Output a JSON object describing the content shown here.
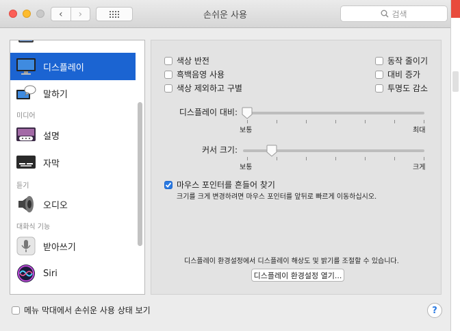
{
  "window": {
    "title": "손쉬운 사용"
  },
  "toolbar": {
    "back": "‹",
    "forward": "›"
  },
  "search": {
    "placeholder": "검색"
  },
  "sidebar": {
    "items": [
      {
        "label": "디스플레이",
        "selected": true
      },
      {
        "label": "말하기"
      },
      {
        "label": "설명"
      },
      {
        "label": "자막"
      },
      {
        "label": "오디오"
      },
      {
        "label": "받아쓰기"
      },
      {
        "label": "Siri"
      }
    ],
    "headers": [
      "미디어",
      "듣기",
      "대화식 기능"
    ]
  },
  "display": {
    "options": {
      "invert_colors": "색상 반전",
      "grayscale": "흑백음영 사용",
      "differentiate": "색상 제외하고 구별",
      "reduce_motion": "동작 줄이기",
      "increase_contrast": "대비 증가",
      "reduce_transparency": "투명도 감소"
    },
    "contrast": {
      "label": "디스플레이 대비:",
      "min": "보통",
      "max": "최대",
      "value": 0
    },
    "cursor": {
      "label": "커서 크기:",
      "min": "보통",
      "max": "크게",
      "value": 0.15
    },
    "shake": {
      "label": "마우스 포인터를 흔들어 찾기",
      "checked": true,
      "hint": "크기를 크게 변경하려면 마우스 포인터를 앞뒤로 빠르게 이동하십시오."
    },
    "footer_text": "디스플레이 환경설정에서 디스플레이 해상도 및 밝기를 조절할 수 있습니다.",
    "open_button": "디스플레이 환경설정 열기..."
  },
  "bottom": {
    "menu_bar_checkbox": "메뉴 막대에서 손쉬운 사용 상태 보기",
    "help": "?"
  },
  "colors": {
    "accent": "#1b64d2",
    "checkbox_on": "#2a7ae2"
  }
}
